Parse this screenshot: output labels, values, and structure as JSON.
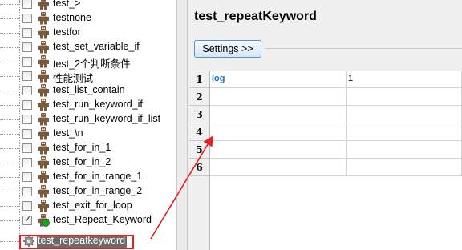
{
  "tree": {
    "items": [
      {
        "label": "test_>",
        "checked": false
      },
      {
        "label": "testnone",
        "checked": false
      },
      {
        "label": "testfor",
        "checked": false
      },
      {
        "label": "test_set_variable_if",
        "checked": false
      },
      {
        "label": "test_2个判断条件",
        "checked": false
      },
      {
        "label": "性能测试",
        "checked": false
      },
      {
        "label": "test_list_contain",
        "checked": false
      },
      {
        "label": "test_run_keyword_if",
        "checked": false
      },
      {
        "label": "test_run_keyword_if_list",
        "checked": false
      },
      {
        "label": "test_\\n",
        "checked": false
      },
      {
        "label": "test_for_in_1",
        "checked": false
      },
      {
        "label": "test_for_in_2",
        "checked": false
      },
      {
        "label": "test_for_in_range_1",
        "checked": false
      },
      {
        "label": "test_for_in_range_2",
        "checked": false
      },
      {
        "label": "test_exit_for_loop",
        "checked": false
      },
      {
        "label": "test_Repeat_Keyword",
        "checked": true,
        "status": "passed"
      }
    ],
    "selected": {
      "label": "test_repeatkeyword",
      "icon": "gear-icon"
    },
    "checkmark": "✓"
  },
  "editor": {
    "title": "test_repeatKeyword",
    "settings_button": "Settings >>",
    "row_headers": [
      "1",
      "2",
      "3",
      "4",
      "5",
      "6"
    ],
    "rows": [
      [
        "log",
        "1",
        ""
      ],
      [
        "",
        "",
        ""
      ],
      [
        "",
        "",
        ""
      ],
      [
        "",
        "",
        ""
      ],
      [
        "",
        "",
        ""
      ],
      [
        "",
        "",
        ""
      ]
    ]
  },
  "colors": {
    "keyword": "#1f6fbf",
    "selection": "#6b6b6b",
    "annotation": "#e41f1f",
    "robot": "#7a5a3a",
    "passed": "#1aa31a"
  }
}
